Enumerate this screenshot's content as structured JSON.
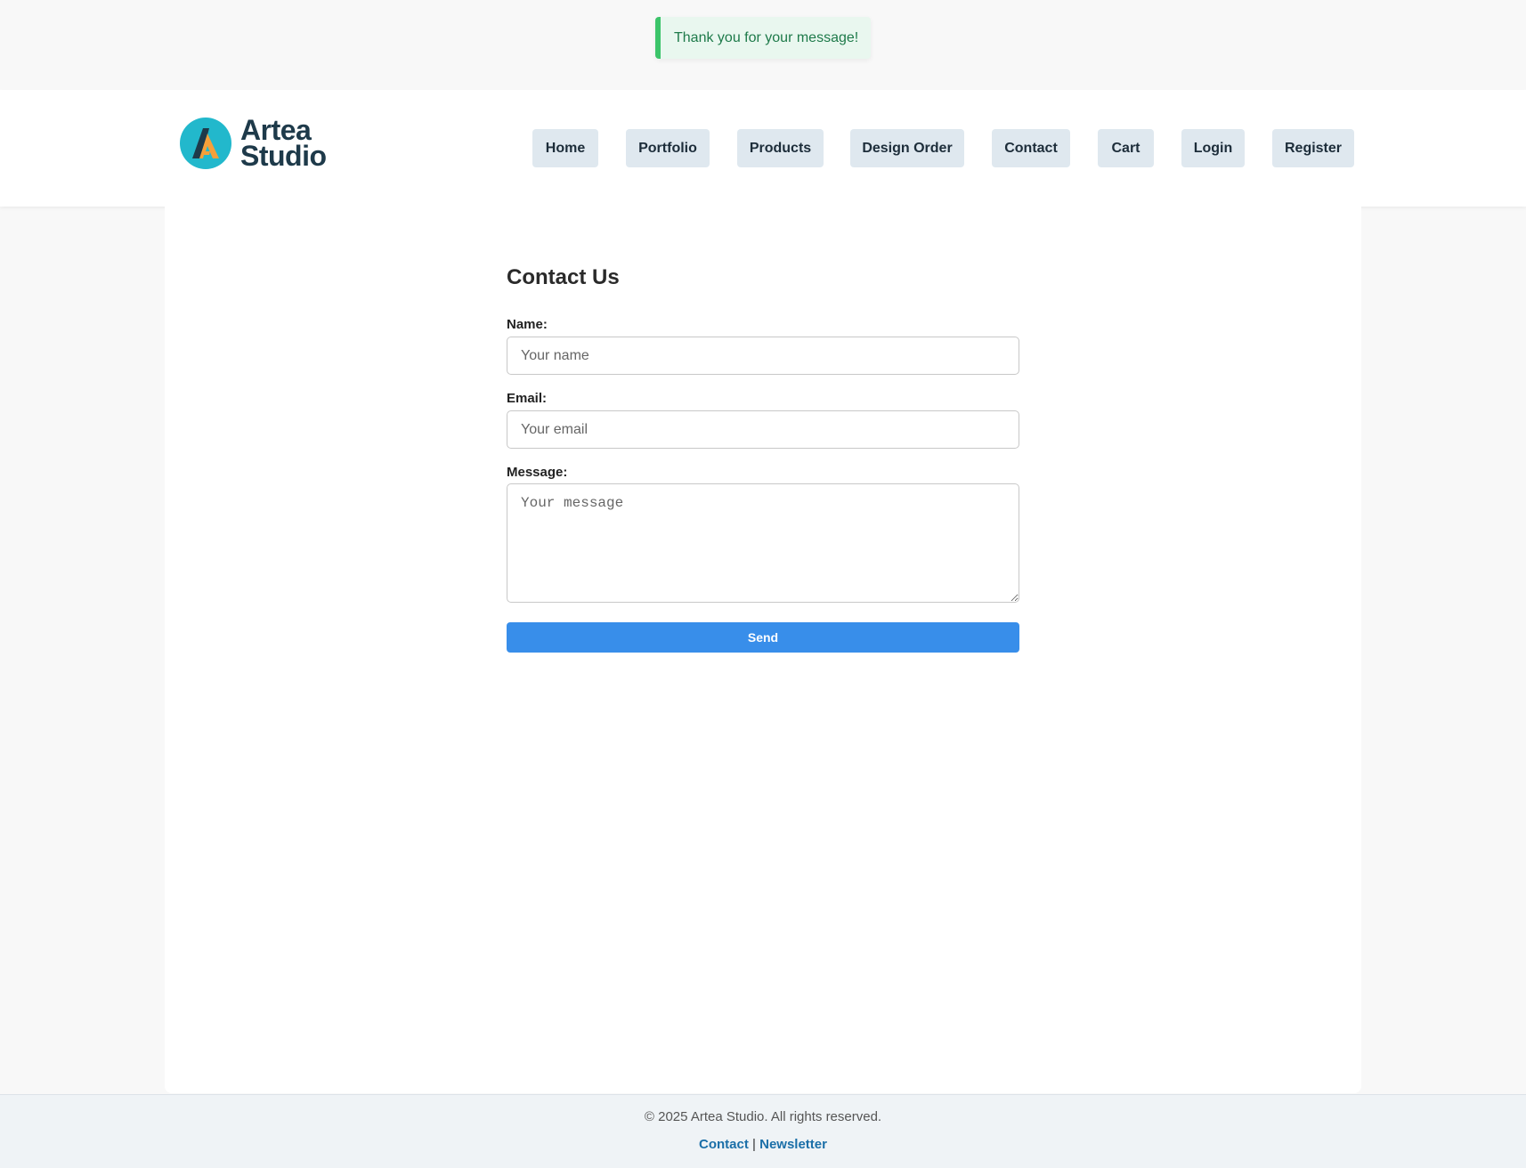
{
  "flash": {
    "message": "Thank you for your message!"
  },
  "brand": {
    "line1": "Artea",
    "line2": "Studio"
  },
  "nav": {
    "items": [
      {
        "label": "Home"
      },
      {
        "label": "Portfolio"
      },
      {
        "label": "Products"
      },
      {
        "label": "Design Order"
      },
      {
        "label": "Contact"
      },
      {
        "label": "Cart"
      },
      {
        "label": "Login"
      },
      {
        "label": "Register"
      }
    ]
  },
  "form": {
    "title": "Contact Us",
    "name_label": "Name:",
    "name_placeholder": "Your name",
    "name_value": "",
    "email_label": "Email:",
    "email_placeholder": "Your email",
    "email_value": "",
    "message_label": "Message:",
    "message_placeholder": "Your message",
    "message_value": "",
    "send_label": "Send"
  },
  "footer": {
    "copyright": "© 2025 Artea Studio. All rights reserved.",
    "link_contact": "Contact",
    "separator": "|",
    "link_newsletter": "Newsletter"
  },
  "colors": {
    "accent": "#388eea",
    "success": "#3cc46a",
    "nav_bg": "#dfe8ef",
    "brand_teal": "#22b8cc",
    "brand_orange": "#f5a03a",
    "brand_navy": "#1e3a4a"
  }
}
